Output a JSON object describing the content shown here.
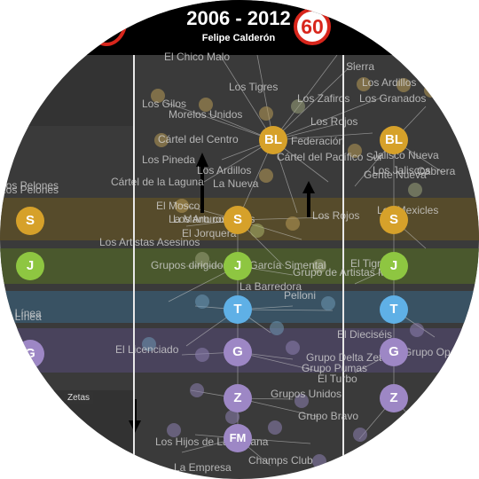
{
  "header": {
    "years": "2006 - 2012",
    "president": "Felipe Calderón",
    "count": "60"
  },
  "colors": {
    "BL": "#d6a12a",
    "S": "#d6a12a",
    "J": "#8ec641",
    "T": "#5fb0e6",
    "G": "#9d87c5",
    "Z": "#9d87c5",
    "FM": "#9d87c5",
    "badge": "#d8261c"
  },
  "nodes": {
    "left_S": "S",
    "left_J": "J",
    "left_G": "G",
    "mid_BL": "BL",
    "mid_S": "S",
    "mid_J": "J",
    "mid_T": "T",
    "mid_G": "G",
    "mid_Z": "Z",
    "mid_FM": "FM",
    "right_BL": "BL",
    "right_S": "S",
    "right_J": "J",
    "right_T": "T",
    "right_G": "G",
    "right_Z": "Z"
  },
  "tags": {
    "zetas": "Zetas"
  },
  "labels": [
    "El Chico Malo",
    "Los Tigres",
    "Los Zafiros",
    "Los Ardillos",
    "Los Granados",
    "Los Gilos",
    "Morelos Unidos",
    "Los Rojos",
    "Cártel del Centro",
    "Federación",
    "Los Pineda",
    "Los Ardillos",
    "Cártel del Pacífico Sur",
    "Cártel de la Laguna",
    "La Nueva",
    "El Mosco",
    "Los Arturos",
    "La Mano con Ojos",
    "El Jorquera",
    "Los Rojos",
    "Los Artistas Asesinos",
    "Los Pelones",
    "Los Mexicles",
    "Grupos dirigidos por García Simental",
    "Grupo de Artistas M3",
    "La Barredora",
    "Pelloni",
    "El Tigre",
    "El Licenciado",
    "Grupo Delta Zeta",
    "Grupo Pumas",
    "El Turbo",
    "Grupos Unidos",
    "Grupo Bravo",
    "Los Hijos de La Hacana",
    "Champs Club",
    "La Empresa",
    "Los Jaliscos",
    "La Línea",
    "Cabrera",
    "Gente Nueva",
    "Sierra",
    "Jalisco Nueva",
    "Los Pelones",
    "La Línea",
    "El Dieciséis",
    "Grupo Operativo"
  ]
}
